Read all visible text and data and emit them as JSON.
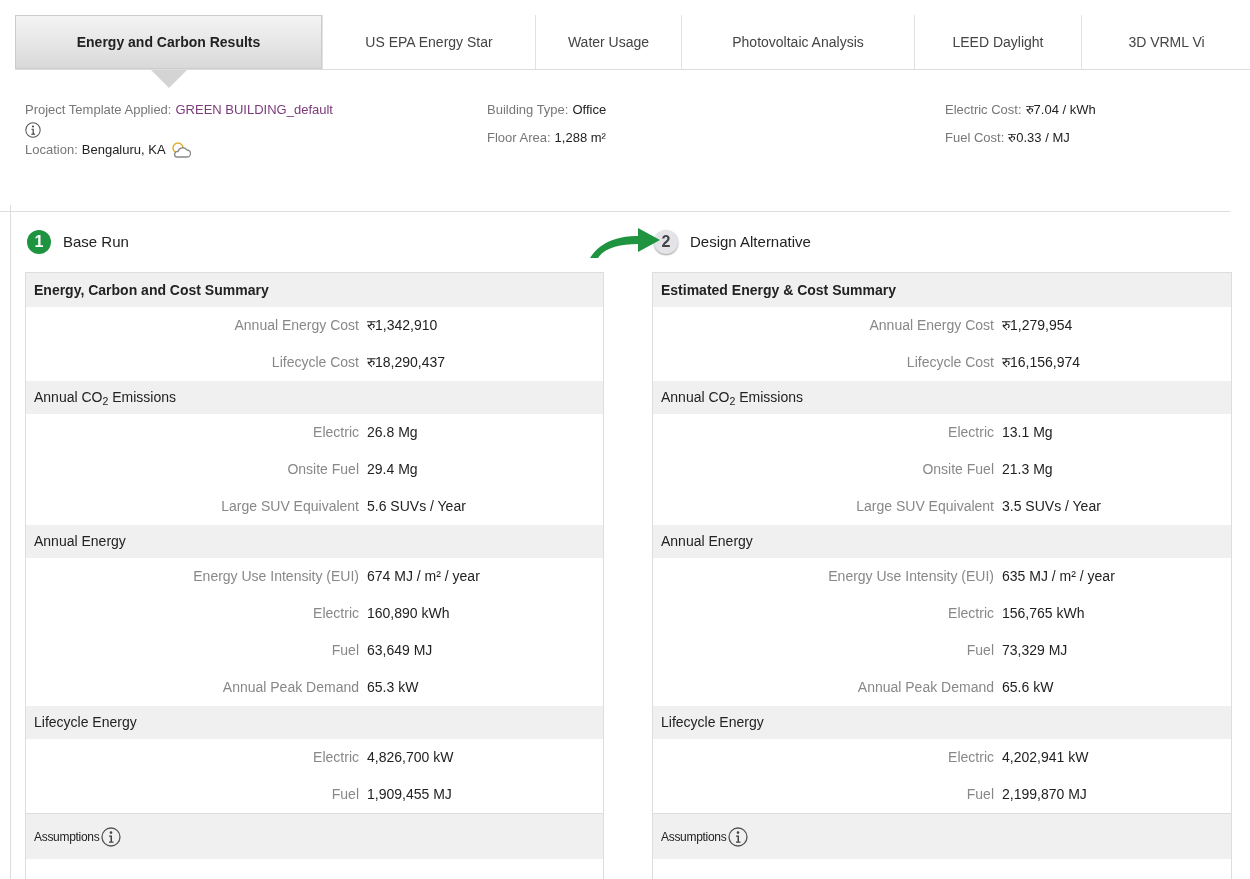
{
  "tabs": [
    {
      "label": "Energy and Carbon Results",
      "selected": true
    },
    {
      "label": "US EPA Energy Star",
      "selected": false
    },
    {
      "label": "Water Usage",
      "selected": false
    },
    {
      "label": "Photovoltaic Analysis",
      "selected": false
    },
    {
      "label": "LEED Daylight",
      "selected": false
    },
    {
      "label": "3D VRML Vi",
      "selected": false
    }
  ],
  "info": {
    "template": {
      "label": "Project Template Applied:",
      "value": "GREEN BUILDING_default"
    },
    "location": {
      "label": "Location:",
      "value": "Bengaluru, KA"
    },
    "building_type": {
      "label": "Building Type:",
      "value": "Office"
    },
    "floor_area": {
      "label": "Floor Area:",
      "value": "1,288 m²"
    },
    "electric_cost": {
      "label": "Electric Cost:",
      "value": "रु7.04 / kWh"
    },
    "fuel_cost": {
      "label": "Fuel Cost:",
      "value": "रु0.33 / MJ"
    }
  },
  "runs": [
    {
      "step": "1",
      "title": "Base Run",
      "active": true,
      "rows": [
        {
          "kind": "header",
          "label": "Energy, Carbon and Cost Summary"
        },
        {
          "kind": "metric",
          "label": "Annual Energy Cost",
          "value": "रु1,342,910"
        },
        {
          "kind": "metric",
          "label": "Lifecycle Cost",
          "value": "रु18,290,437"
        },
        {
          "kind": "section",
          "label": "Annual CO$_{2}$ Emissions"
        },
        {
          "kind": "metric",
          "label": "Electric",
          "value": "26.8 Mg"
        },
        {
          "kind": "metric",
          "label": "Onsite Fuel",
          "value": "29.4 Mg"
        },
        {
          "kind": "metric",
          "label": "Large SUV Equivalent",
          "value": "5.6 SUVs / Year"
        },
        {
          "kind": "section",
          "label": "Annual Energy"
        },
        {
          "kind": "metric",
          "label": "Energy Use Intensity (EUI)",
          "value": "674 MJ / m² / year"
        },
        {
          "kind": "metric",
          "label": "Electric",
          "value": "160,890 kWh"
        },
        {
          "kind": "metric",
          "label": "Fuel",
          "value": "63,649 MJ"
        },
        {
          "kind": "metric",
          "label": "Annual Peak Demand",
          "value": "65.3 kW"
        },
        {
          "kind": "section",
          "label": "Lifecycle Energy"
        },
        {
          "kind": "metric",
          "label": "Electric",
          "value": "4,826,700 kW"
        },
        {
          "kind": "metric",
          "label": "Fuel",
          "value": "1,909,455 MJ"
        },
        {
          "kind": "footer",
          "label": "Assumptions"
        }
      ]
    },
    {
      "step": "2",
      "title": "Design Alternative",
      "active": false,
      "rows": [
        {
          "kind": "header",
          "label": "Estimated Energy & Cost Summary"
        },
        {
          "kind": "metric",
          "label": "Annual Energy Cost",
          "value": "रु1,279,954"
        },
        {
          "kind": "metric",
          "label": "Lifecycle Cost",
          "value": "रु16,156,974"
        },
        {
          "kind": "section",
          "label": "Annual CO$_{2}$ Emissions"
        },
        {
          "kind": "metric",
          "label": "Electric",
          "value": "13.1 Mg"
        },
        {
          "kind": "metric",
          "label": "Onsite Fuel",
          "value": "21.3 Mg"
        },
        {
          "kind": "metric",
          "label": "Large SUV Equivalent",
          "value": "3.5 SUVs / Year"
        },
        {
          "kind": "section",
          "label": "Annual Energy"
        },
        {
          "kind": "metric",
          "label": "Energy Use Intensity (EUI)",
          "value": "635 MJ / m² / year"
        },
        {
          "kind": "metric",
          "label": "Electric",
          "value": "156,765 kWh"
        },
        {
          "kind": "metric",
          "label": "Fuel",
          "value": "73,329 MJ"
        },
        {
          "kind": "metric",
          "label": "Annual Peak Demand",
          "value": "65.6 kW"
        },
        {
          "kind": "section",
          "label": "Lifecycle Energy"
        },
        {
          "kind": "metric",
          "label": "Electric",
          "value": "4,202,941 kW"
        },
        {
          "kind": "metric",
          "label": "Fuel",
          "value": "2,199,870 MJ"
        },
        {
          "kind": "footer",
          "label": "Assumptions"
        }
      ]
    }
  ]
}
